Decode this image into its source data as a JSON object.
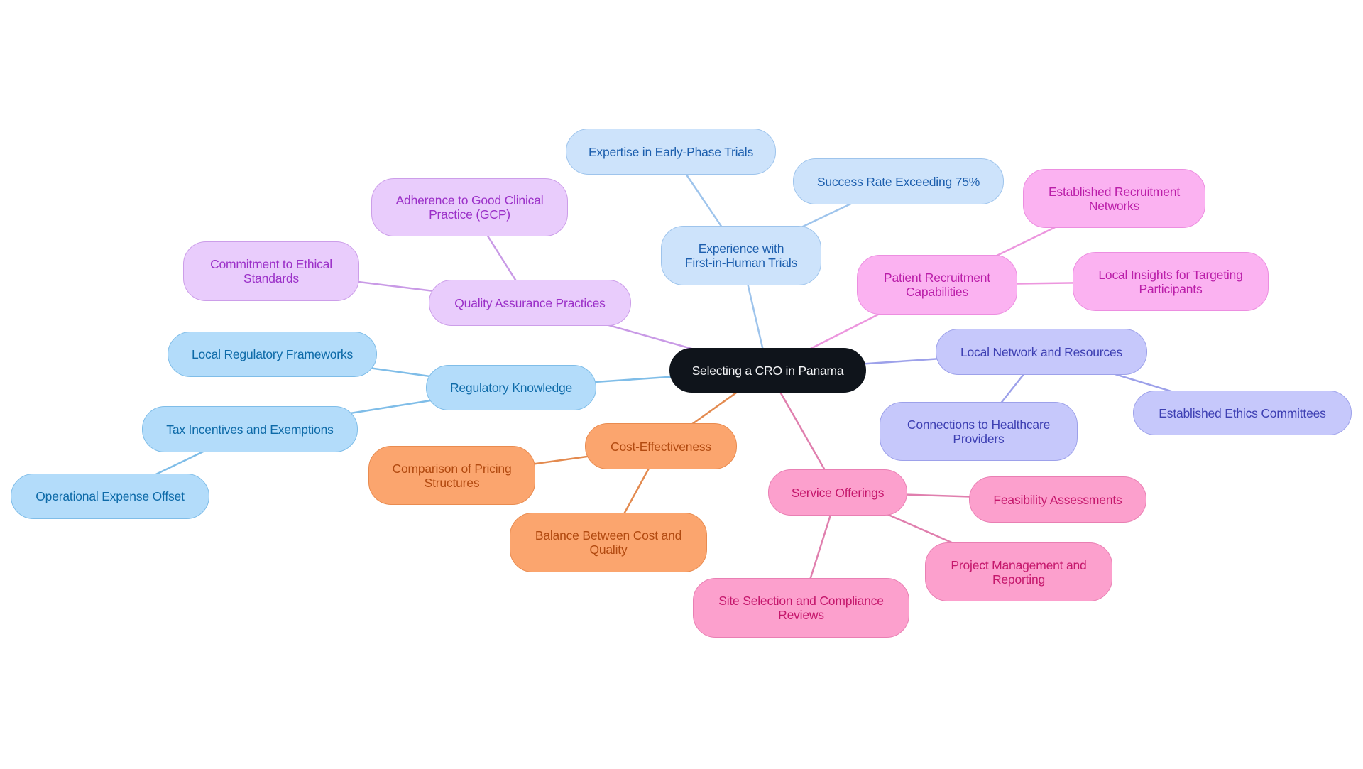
{
  "diagram": {
    "type": "mind-map",
    "root": {
      "id": "root",
      "label": "Selecting a CRO in Panama"
    },
    "branches": [
      {
        "id": "experience",
        "label": "Experience with First-in-Human Trials",
        "lines": [
          "Experience with",
          "First-in-Human Trials"
        ],
        "color": "blue1",
        "edge_color": "#9ec4ec",
        "children": [
          {
            "id": "expertise",
            "label": "Expertise in Early-Phase Trials",
            "lines": [
              "Expertise in Early-Phase Trials"
            ]
          },
          {
            "id": "success",
            "label": "Success Rate Exceeding 75%",
            "lines": [
              "Success Rate Exceeding 75%"
            ]
          }
        ]
      },
      {
        "id": "quality",
        "label": "Quality Assurance Practices",
        "lines": [
          "Quality Assurance Practices"
        ],
        "color": "purple",
        "edge_color": "#c99ae6",
        "children": [
          {
            "id": "gcp",
            "label": "Adherence to Good Clinical Practice (GCP)",
            "lines": [
              "Adherence to Good Clinical",
              "Practice (GCP)"
            ]
          },
          {
            "id": "ethical",
            "label": "Commitment to Ethical Standards",
            "lines": [
              "Commitment to Ethical",
              "Standards"
            ]
          }
        ]
      },
      {
        "id": "regulatory",
        "label": "Regulatory Knowledge",
        "lines": [
          "Regulatory Knowledge"
        ],
        "color": "blue2",
        "edge_color": "#7fbde8",
        "children": [
          {
            "id": "frameworks",
            "label": "Local Regulatory Frameworks",
            "lines": [
              "Local Regulatory Frameworks"
            ]
          },
          {
            "id": "tax",
            "label": "Tax Incentives and Exemptions",
            "lines": [
              "Tax Incentives and Exemptions"
            ],
            "children": [
              {
                "id": "opex",
                "label": "Operational Expense Offset",
                "lines": [
                  "Operational Expense Offset"
                ]
              }
            ]
          }
        ]
      },
      {
        "id": "cost",
        "label": "Cost-Effectiveness",
        "lines": [
          "Cost-Effectiveness"
        ],
        "color": "orange",
        "edge_color": "#e38a4f",
        "children": [
          {
            "id": "pricing",
            "label": "Comparison of Pricing Structures",
            "lines": [
              "Comparison of Pricing",
              "Structures"
            ]
          },
          {
            "id": "balance",
            "label": "Balance Between Cost and Quality",
            "lines": [
              "Balance Between Cost and",
              "Quality"
            ]
          }
        ]
      },
      {
        "id": "services",
        "label": "Service Offerings",
        "lines": [
          "Service Offerings"
        ],
        "color": "pink",
        "edge_color": "#e07fae",
        "children": [
          {
            "id": "feasibility",
            "label": "Feasibility Assessments",
            "lines": [
              "Feasibility Assessments"
            ]
          },
          {
            "id": "project",
            "label": "Project Management and Reporting",
            "lines": [
              "Project Management and",
              "Reporting"
            ]
          },
          {
            "id": "site",
            "label": "Site Selection and Compliance Reviews",
            "lines": [
              "Site Selection and Compliance",
              "Reviews"
            ]
          }
        ]
      },
      {
        "id": "recruitment",
        "label": "Patient Recruitment Capabilities",
        "lines": [
          "Patient Recruitment",
          "Capabilities"
        ],
        "color": "magenta",
        "edge_color": "#ec96de",
        "children": [
          {
            "id": "networks",
            "label": "Established Recruitment Networks",
            "lines": [
              "Established Recruitment",
              "Networks"
            ]
          },
          {
            "id": "insights",
            "label": "Local Insights for Targeting Participants",
            "lines": [
              "Local Insights for Targeting",
              "Participants"
            ]
          }
        ]
      },
      {
        "id": "network",
        "label": "Local Network and Resources",
        "lines": [
          "Local Network and Resources"
        ],
        "color": "indigo",
        "edge_color": "#9da1ea",
        "children": [
          {
            "id": "healthcare",
            "label": "Connections to Healthcare Providers",
            "lines": [
              "Connections to Healthcare",
              "Providers"
            ]
          },
          {
            "id": "ethics",
            "label": "Established Ethics Committees",
            "lines": [
              "Established Ethics Committees"
            ]
          }
        ]
      }
    ]
  }
}
